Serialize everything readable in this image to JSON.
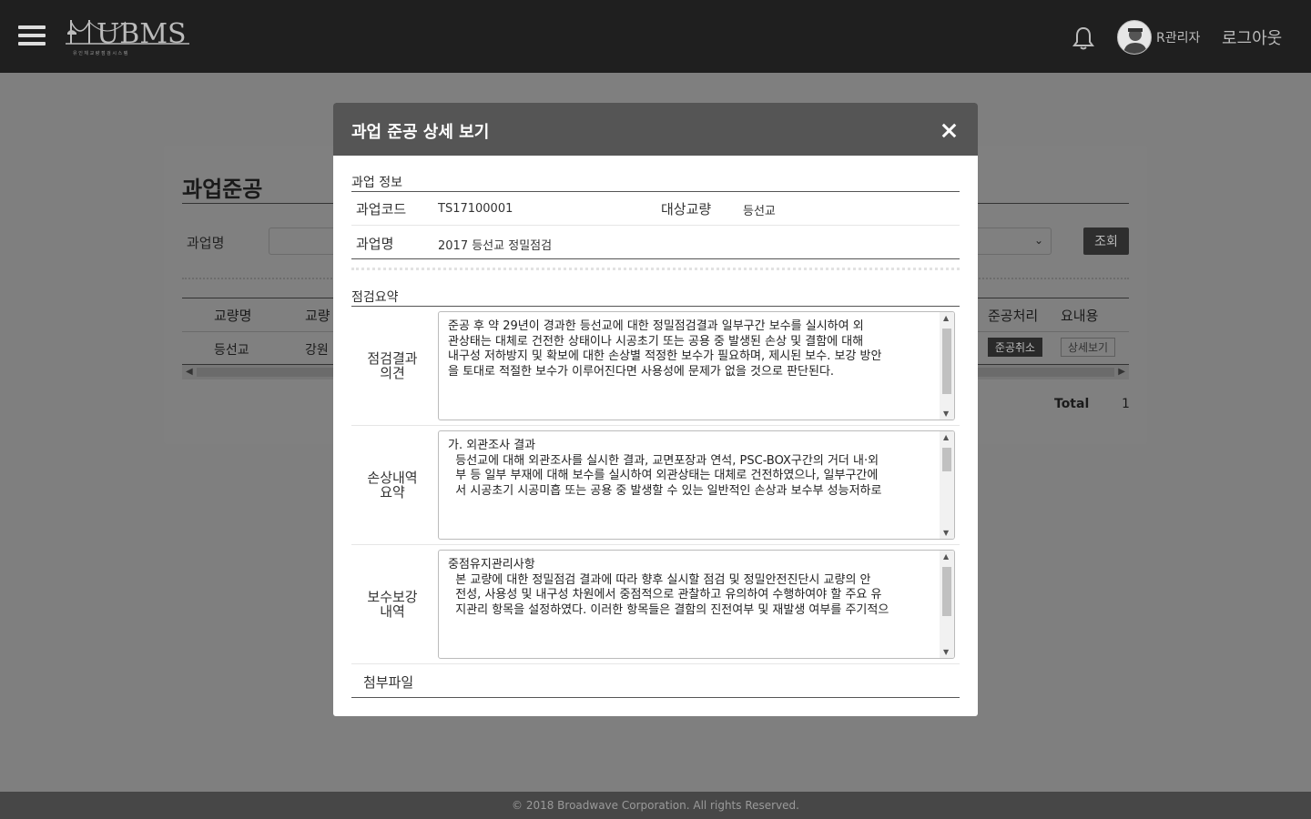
{
  "header": {
    "logo_text": "UBMS",
    "logo_subtitle": "유 인 체   교 량 점 검 시 스 템",
    "user_name": "R관리자",
    "logout_label": "로그아웃"
  },
  "page": {
    "title": "과업준공",
    "filter_label": "과업명",
    "search_label": "조회",
    "columns": [
      "교량명",
      "교량",
      "준공처리",
      "요내용"
    ],
    "row": {
      "bridge": "등선교",
      "region": "강원",
      "cancel_label": "준공취소",
      "detail_label": "상세보기"
    },
    "total_label": "Total",
    "total_value": "1"
  },
  "footer": {
    "copyright": "© 2018 Broadwave Corporation. All rights Reserved."
  },
  "modal": {
    "title": "과업 준공 상세 보기",
    "info_section": "과업 정보",
    "code_label": "과업코드",
    "code_value": "TS17100001",
    "target_label": "대상교량",
    "target_value": "등선교",
    "name_label": "과업명",
    "name_value": "2017 등선교 정밀점검",
    "summary_section": "점검요약",
    "opinion_label": "점검결과\n의견",
    "opinion_text": "준공 후 약 29년이 경과한 등선교에 대한 정밀점검결과 일부구간 보수를 실시하여 외\n관상태는 대체로 건전한 상태이나 시공초기 또는 공용 중 발생된 손상 및 결함에 대해\n내구성 저하방지 및 확보에 대한 손상별 적정한 보수가 필요하며, 제시된 보수. 보강 방안\n을 토대로 적절한 보수가 이루어진다면 사용성에 문제가 없을 것으로 판단된다.",
    "damage_label": "손상내역\n요약",
    "damage_text": "가. 외관조사 결과\n  등선교에 대해 외관조사를 실시한 결과, 교면포장과 연석, PSC-BOX구간의 거더 내·외\n  부 등 일부 부재에 대해 보수를 실시하여 외관상태는 대체로 건전하였으나, 일부구간에\n  서 시공초기 시공미흡 또는 공용 중 발생할 수 있는 일반적인 손상과 보수부 성능저하로",
    "repair_label": "보수보강\n내역",
    "repair_text": "중점유지관리사항\n  본 교량에 대한 정밀점검 결과에 따라 향후 실시할 점검 및 정밀안전진단시 교량의 안\n  전성, 사용성 및 내구성 차원에서 중점적으로 관찰하고 유의하여 수행하여야 할 주요 유\n  지관리 항목을 설정하였다. 이러한 항목들은 결함의 진전여부 및 재발생 여부를 주기적으",
    "attach_label": "첨부파일"
  }
}
